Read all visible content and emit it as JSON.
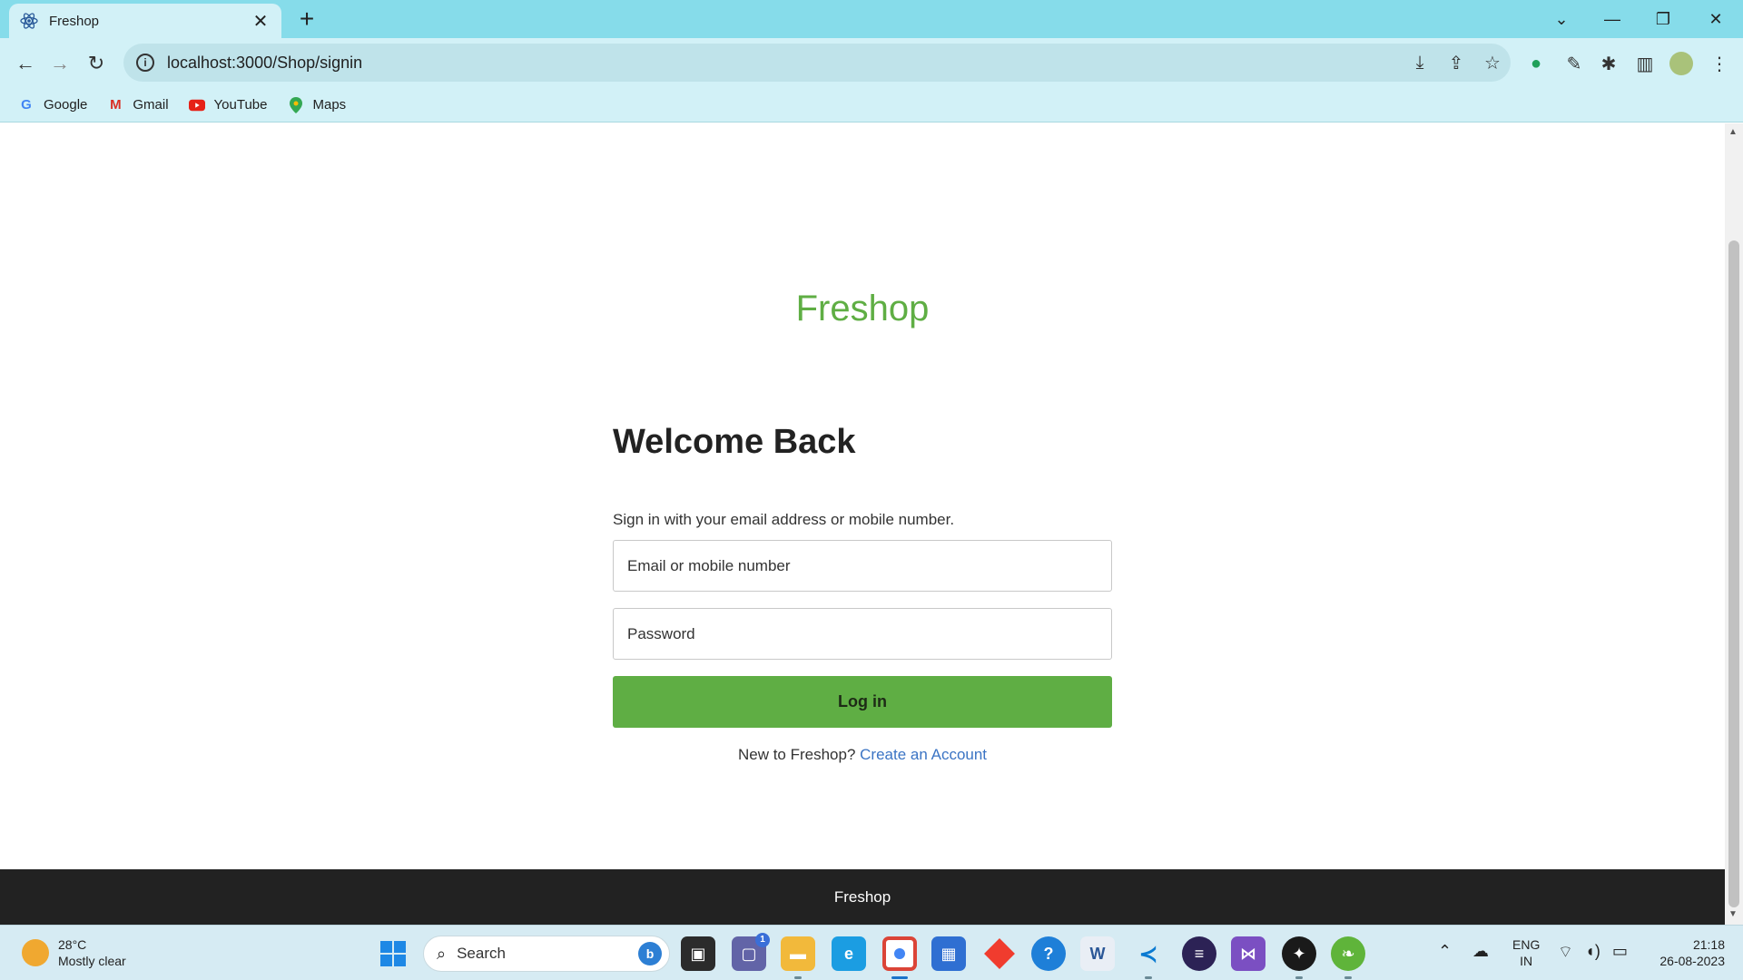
{
  "browser": {
    "tab_title": "Freshop",
    "url": "localhost:3000/Shop/signin",
    "bookmarks": [
      {
        "label": "Google",
        "icon": "google-icon"
      },
      {
        "label": "Gmail",
        "icon": "gmail-icon"
      },
      {
        "label": "YouTube",
        "icon": "youtube-icon"
      },
      {
        "label": "Maps",
        "icon": "maps-icon"
      }
    ]
  },
  "page": {
    "brand": "Freshop",
    "heading": "Welcome Back",
    "subtitle": "Sign in with your email address or mobile number.",
    "email_placeholder": "Email or mobile number",
    "password_placeholder": "Password",
    "login_label": "Log in",
    "signup_prompt": "New to Freshop?",
    "signup_link": "Create an Account",
    "footer": "Freshop",
    "colors": {
      "brand": "#5fae44",
      "link": "#3b74c4",
      "footer_bg": "#222222"
    }
  },
  "taskbar": {
    "weather_temp": "28°C",
    "weather_desc": "Mostly clear",
    "search_label": "Search",
    "chat_badge": "1",
    "lang_top": "ENG",
    "lang_bottom": "IN",
    "time": "21:18",
    "date": "26-08-2023"
  }
}
